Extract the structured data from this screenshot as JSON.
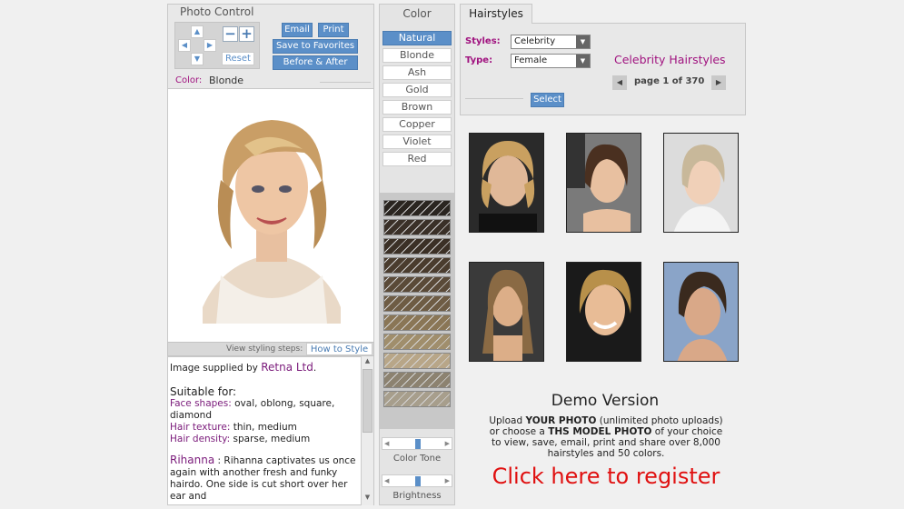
{
  "photo_control": {
    "title": "Photo Control",
    "email_label": "Email",
    "print_label": "Print",
    "save_favorites_label": "Save to Favorites",
    "before_after_label": "Before & After",
    "reset_label": "Reset",
    "minus_label": "−",
    "plus_label": "+",
    "color_label": "Color:",
    "color_value": "Blonde",
    "view_steps_label": "View styling steps:",
    "how_to_style_label": "How to Style"
  },
  "description": {
    "supplied_prefix": "Image supplied by ",
    "supplied_by": "Retna Ltd",
    "supplied_suffix": ".",
    "suitable_heading": "Suitable for:",
    "face_label": "Face shapes:",
    "face_value": " oval, oblong, square, diamond",
    "texture_label": "Hair texture:",
    "texture_value": " thin, medium",
    "density_label": "Hair density:",
    "density_value": " sparse, medium",
    "celeb_name": "Rihanna",
    "celeb_text": " : Rihanna captivates us once again with another fresh and funky hairdo. One side is cut short over her ear and"
  },
  "color_panel": {
    "title": "Color",
    "options": [
      "Natural",
      "Blonde",
      "Ash",
      "Gold",
      "Brown",
      "Copper",
      "Violet",
      "Red"
    ],
    "selected": "Natural",
    "swatches": [
      "#2a2520",
      "#3a3028",
      "#3b3026",
      "#4a3c2e",
      "#5a4a38",
      "#6e5c44",
      "#8a7656",
      "#a08e6c",
      "#b8a688",
      "#8c8270",
      "#a79e8c"
    ],
    "color_tone_label": "Color Tone",
    "brightness_label": "Brightness",
    "color_tone_level": 0.5,
    "brightness_level": 0.5
  },
  "hairstyles": {
    "tab_label": "Hairstyles",
    "styles_label": "Styles:",
    "styles_value": "Celebrity",
    "type_label": "Type:",
    "type_value": "Female",
    "heading": "Celebrity Hairstyles",
    "page_text": "page 1 of 370",
    "select_label": "Select",
    "demo_title": "Demo Version",
    "demo_line1_a": "Upload ",
    "demo_line1_b": "YOUR PHOTO",
    "demo_line1_c": " (unlimited photo uploads)",
    "demo_line2_a": "or choose a ",
    "demo_line2_b": "THS MODEL PHOTO",
    "demo_line2_c": " of your choice",
    "demo_line3": "to view, save, email, print and share over 8,000",
    "demo_line4": "hairstyles and 50 colors.",
    "register_label": "Click here to register"
  },
  "colors": {
    "accent": "#5b8fc8",
    "magenta": "#a0127f",
    "register_red": "#e01010"
  }
}
